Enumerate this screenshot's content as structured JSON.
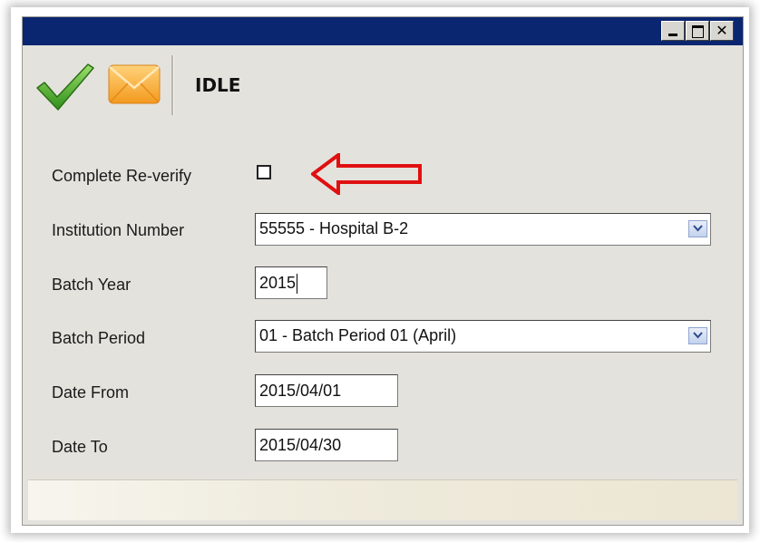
{
  "toolbar": {
    "status": "IDLE",
    "check_icon": "check-icon",
    "mail_icon": "envelope-icon"
  },
  "window_buttons": [
    "minimize",
    "maximize",
    "close"
  ],
  "form": {
    "complete_reverify": {
      "label": "Complete Re-verify",
      "checked": false
    },
    "institution_number": {
      "label": "Institution Number",
      "value": "55555 - Hospital B-2"
    },
    "batch_year": {
      "label": "Batch Year",
      "value": "2015"
    },
    "batch_period": {
      "label": "Batch Period",
      "value": "01 - Batch Period 01 (April)"
    },
    "date_from": {
      "label": "Date From",
      "value": "2015/04/01"
    },
    "date_to": {
      "label": "Date To",
      "value": "2015/04/30"
    }
  },
  "colors": {
    "titlebar": "#0b2670",
    "window_bg": "#e4e2dc",
    "arrow": "#e01010",
    "check": "#4caf2a",
    "envelope": "#f5a623"
  }
}
